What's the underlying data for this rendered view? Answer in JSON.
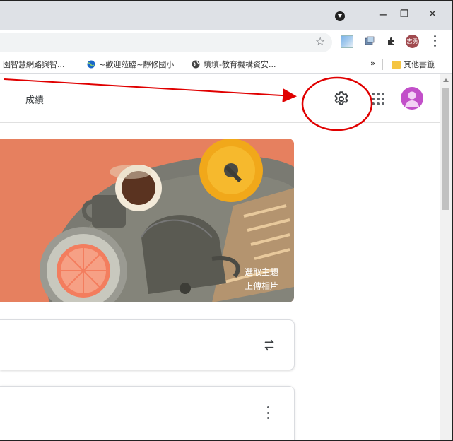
{
  "window": {
    "minimize_glyph": "−",
    "restore_glyph": "❐",
    "close_glyph": "✕"
  },
  "toolbar": {
    "star_glyph": "☆",
    "avatar_text": "志勇"
  },
  "bookmarks": {
    "items": [
      {
        "label": "園智慧網路與智..."
      },
      {
        "label": "~歡迎蒞臨~靜修國小"
      },
      {
        "label": "填填-教育機構資安..."
      }
    ],
    "overflow_label": "»",
    "other_label": "其他書籤"
  },
  "page": {
    "tab_label": "成績"
  },
  "banner": {
    "select_theme": "選取主題",
    "upload_photo": "上傳相片",
    "colors": {
      "background": "#e6805f",
      "table": "#7f7f78",
      "cup": "#f5b020"
    }
  },
  "annotation": {
    "color": "#e00000"
  },
  "icons": [
    "gear-icon",
    "apps-grid-icon",
    "star-icon",
    "swap-icon",
    "more-vert-icon",
    "folder-icon"
  ]
}
